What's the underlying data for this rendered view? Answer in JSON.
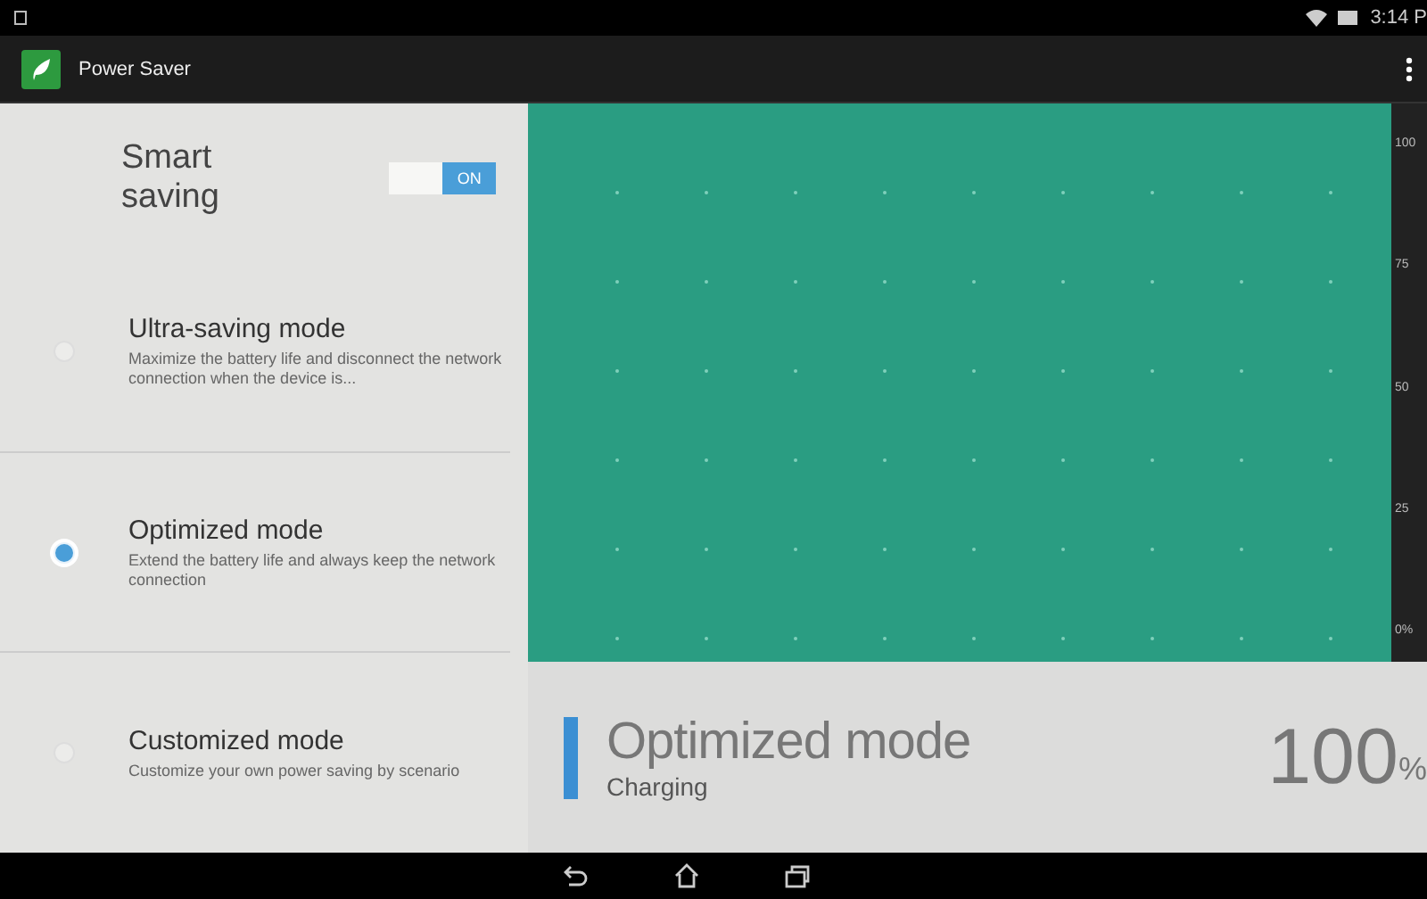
{
  "status_bar": {
    "time": "3:14 P"
  },
  "app_bar": {
    "title": "Power Saver"
  },
  "smart_saving": {
    "label": "Smart saving",
    "on": true,
    "toggle_label": "ON"
  },
  "modes": [
    {
      "title": "Ultra-saving mode",
      "description": "Maximize the battery life and disconnect the network connection when the device is...",
      "selected": false
    },
    {
      "title": "Optimized mode",
      "description": "Extend the battery life and always keep the network connection",
      "selected": true
    },
    {
      "title": "Customized mode",
      "description": "Customize your own power saving by scenario",
      "selected": false
    }
  ],
  "chart": {
    "axis_labels": [
      "100",
      "75",
      "50",
      "25",
      "0%"
    ]
  },
  "summary": {
    "mode": "Optimized mode",
    "status": "Charging",
    "percent": "100",
    "unit": "%"
  }
}
